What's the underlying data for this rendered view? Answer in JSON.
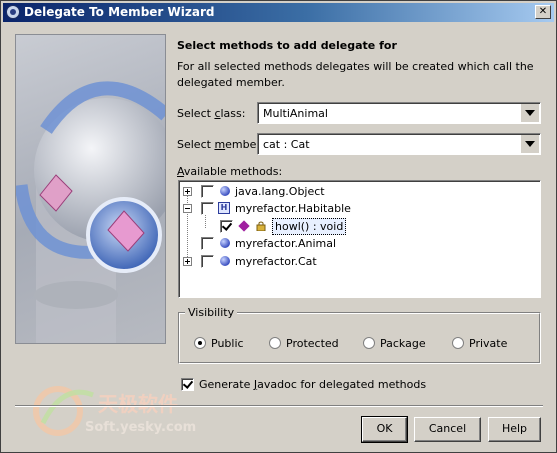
{
  "window": {
    "title": "Delegate To Member Wizard",
    "close_label": "✕"
  },
  "heading": "Select methods to add delegate for",
  "description": "For all selected methods delegates will be created which call the delegated member.",
  "select_class": {
    "label_pre": "Select ",
    "label_key": "c",
    "label_post": "lass:",
    "value": "MultiAnimal"
  },
  "select_member": {
    "label_pre": "Select ",
    "label_key": "m",
    "label_post": "ember:",
    "value": "cat : Cat"
  },
  "methods": {
    "label_key": "A",
    "label_rest": "vailable methods:",
    "tree": [
      {
        "label": "java.lang.Object",
        "expander": "plus",
        "checked": false,
        "icon": "class-ball-icon"
      },
      {
        "label": "myrefactor.Habitable",
        "expander": "minus",
        "checked": false,
        "icon": "interface-icon"
      },
      {
        "label": "howl() : void",
        "expander": "",
        "checked": true,
        "icon": "method-icon",
        "selected": true
      },
      {
        "label": "myrefactor.Animal",
        "expander": "",
        "checked": false,
        "icon": "class-ball-icon"
      },
      {
        "label": "myrefactor.Cat",
        "expander": "plus",
        "checked": false,
        "icon": "class-ball-icon"
      }
    ]
  },
  "visibility": {
    "title": "Visibility",
    "options": [
      {
        "label": "Public",
        "selected": true
      },
      {
        "label": "Protected",
        "selected": false
      },
      {
        "label": "Package",
        "selected": false
      },
      {
        "label": "Private",
        "selected": false
      }
    ]
  },
  "javadoc": {
    "checked": true,
    "label_pre": "Generate ",
    "label_key": "J",
    "label_post": "avadoc for delegated methods"
  },
  "buttons": {
    "ok": "OK",
    "cancel": "Cancel",
    "help": "Help"
  },
  "watermark": {
    "text_cn": "天极软件",
    "text_url": "Soft.yesky.com"
  }
}
